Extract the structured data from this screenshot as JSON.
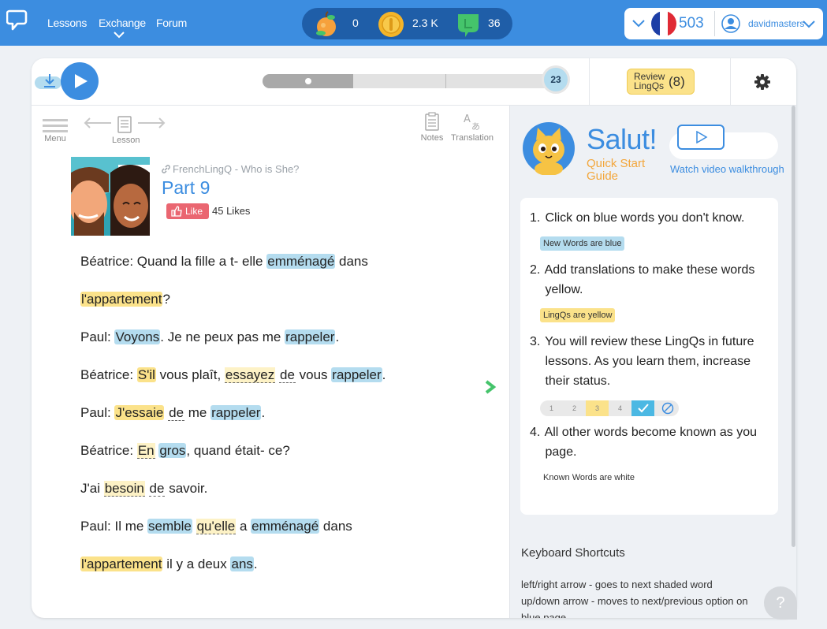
{
  "topbar": {
    "nav": [
      {
        "label": "Lessons"
      },
      {
        "label": "Exchange"
      },
      {
        "label": "Forum"
      }
    ],
    "stats": [
      {
        "icon": "apple-icon",
        "value": "0"
      },
      {
        "icon": "coin-icon",
        "value": "2.3 K"
      },
      {
        "icon": "lingq-icon",
        "value": "36"
      }
    ],
    "language": {
      "flag": "france-flag-icon",
      "count": "503"
    },
    "user": {
      "name": "davidmasters"
    }
  },
  "player": {
    "progress": 0.31,
    "page": "23",
    "review": {
      "label": "Review LingQs",
      "label_line1": "Review",
      "label_line2": "LingQs",
      "count": "(8)"
    }
  },
  "toolbar": {
    "menu": "Menu",
    "lesson": "Lesson",
    "notes": "Notes",
    "translation": "Translation"
  },
  "lesson": {
    "course": "FrenchLingQ - Who is She?",
    "title": "Part 9",
    "like_label": "Like",
    "likes": "45 Likes"
  },
  "text": [
    {
      "line": 0,
      "words": [
        [
          "Béatrice: Quand la fille a t- elle ",
          ""
        ],
        [
          "emménagé",
          "blue"
        ],
        [
          " dans",
          ""
        ]
      ]
    },
    {
      "line": 1,
      "words": [
        [
          "l'appartement",
          "yellow"
        ],
        [
          "?",
          ""
        ]
      ]
    },
    {
      "line": 2,
      "words": [
        [
          "Paul: ",
          ""
        ],
        [
          "Voyons",
          "blue"
        ],
        [
          ". Je ne peux pas me ",
          ""
        ],
        [
          "rappeler",
          "blue"
        ],
        [
          ".",
          ""
        ]
      ]
    },
    {
      "line": 3,
      "words": [
        [
          "Béatrice: ",
          ""
        ],
        [
          "S'il",
          "yellow"
        ],
        [
          " vous plaît, ",
          ""
        ],
        [
          "essayez",
          "ypale"
        ],
        [
          " ",
          ""
        ],
        [
          "de",
          "known"
        ],
        [
          " vous ",
          ""
        ],
        [
          "rappeler",
          "blue"
        ],
        [
          ".",
          ""
        ]
      ]
    },
    {
      "line": 4,
      "words": [
        [
          "Paul: ",
          ""
        ],
        [
          "J'essaie",
          "yellow"
        ],
        [
          " ",
          ""
        ],
        [
          "de",
          "known"
        ],
        [
          " me ",
          ""
        ],
        [
          "rappeler",
          "blue"
        ],
        [
          ".",
          ""
        ]
      ]
    },
    {
      "line": 5,
      "words": [
        [
          "Béatrice: ",
          ""
        ],
        [
          "En",
          "ypale"
        ],
        [
          " ",
          ""
        ],
        [
          "gros",
          "blue"
        ],
        [
          ", quand était- ce?",
          ""
        ]
      ]
    },
    {
      "line": 6,
      "words": [
        [
          "J'ai ",
          ""
        ],
        [
          "besoin",
          "ypale"
        ],
        [
          " ",
          ""
        ],
        [
          "de",
          "known"
        ],
        [
          " savoir.",
          ""
        ]
      ]
    },
    {
      "line": 7,
      "words": [
        [
          "Paul: Il me ",
          ""
        ],
        [
          "semble",
          "blue"
        ],
        [
          " ",
          ""
        ],
        [
          "qu'elle",
          "ypale"
        ],
        [
          " a ",
          ""
        ],
        [
          "emménagé",
          "blue"
        ],
        [
          " dans",
          ""
        ]
      ]
    },
    {
      "line": 8,
      "words": [
        [
          "l'appartement",
          "yellow"
        ],
        [
          " il y a deux ",
          ""
        ],
        [
          "ans",
          "blue"
        ],
        [
          ".",
          ""
        ]
      ]
    }
  ],
  "guide": {
    "greeting": "Salut!",
    "quick_start": "Quick Start Guide",
    "quick_start_line1": "Quick Start",
    "quick_start_line2": "Guide",
    "video_link": "Watch video walkthrough",
    "steps": [
      {
        "num": "1.",
        "lines": [
          "Click on blue words you don't know."
        ]
      },
      {
        "num": "2.",
        "lines": [
          "Add translations to make these words",
          "yellow."
        ]
      },
      {
        "num": "3.",
        "lines": [
          "You will review these LingQs in future",
          "lessons. As you learn them, increase",
          "their status."
        ]
      },
      {
        "num": "4.",
        "lines": [
          "All other words become known as you",
          "page."
        ]
      }
    ],
    "pills": {
      "blue": "New Words are blue",
      "yellow": "LingQs are yellow",
      "white": "Known Words are white"
    },
    "statuses": [
      "1",
      "2",
      "3",
      "4"
    ],
    "status_colors": {
      "selected": "#4bb8e3",
      "level3": "#fbe28a"
    }
  },
  "shortcuts": {
    "title": "Keyboard Shortcuts",
    "lines": [
      "left/right arrow - goes to next shaded word",
      "up/down arrow - moves to next/previous option on",
      "blue page"
    ]
  },
  "help": "?",
  "colors": {
    "brand": "#3c8de0",
    "blue_word": "#b4dcef",
    "yellow_word": "#fbe28a",
    "like": "#ea6671",
    "next": "#45c46b"
  }
}
